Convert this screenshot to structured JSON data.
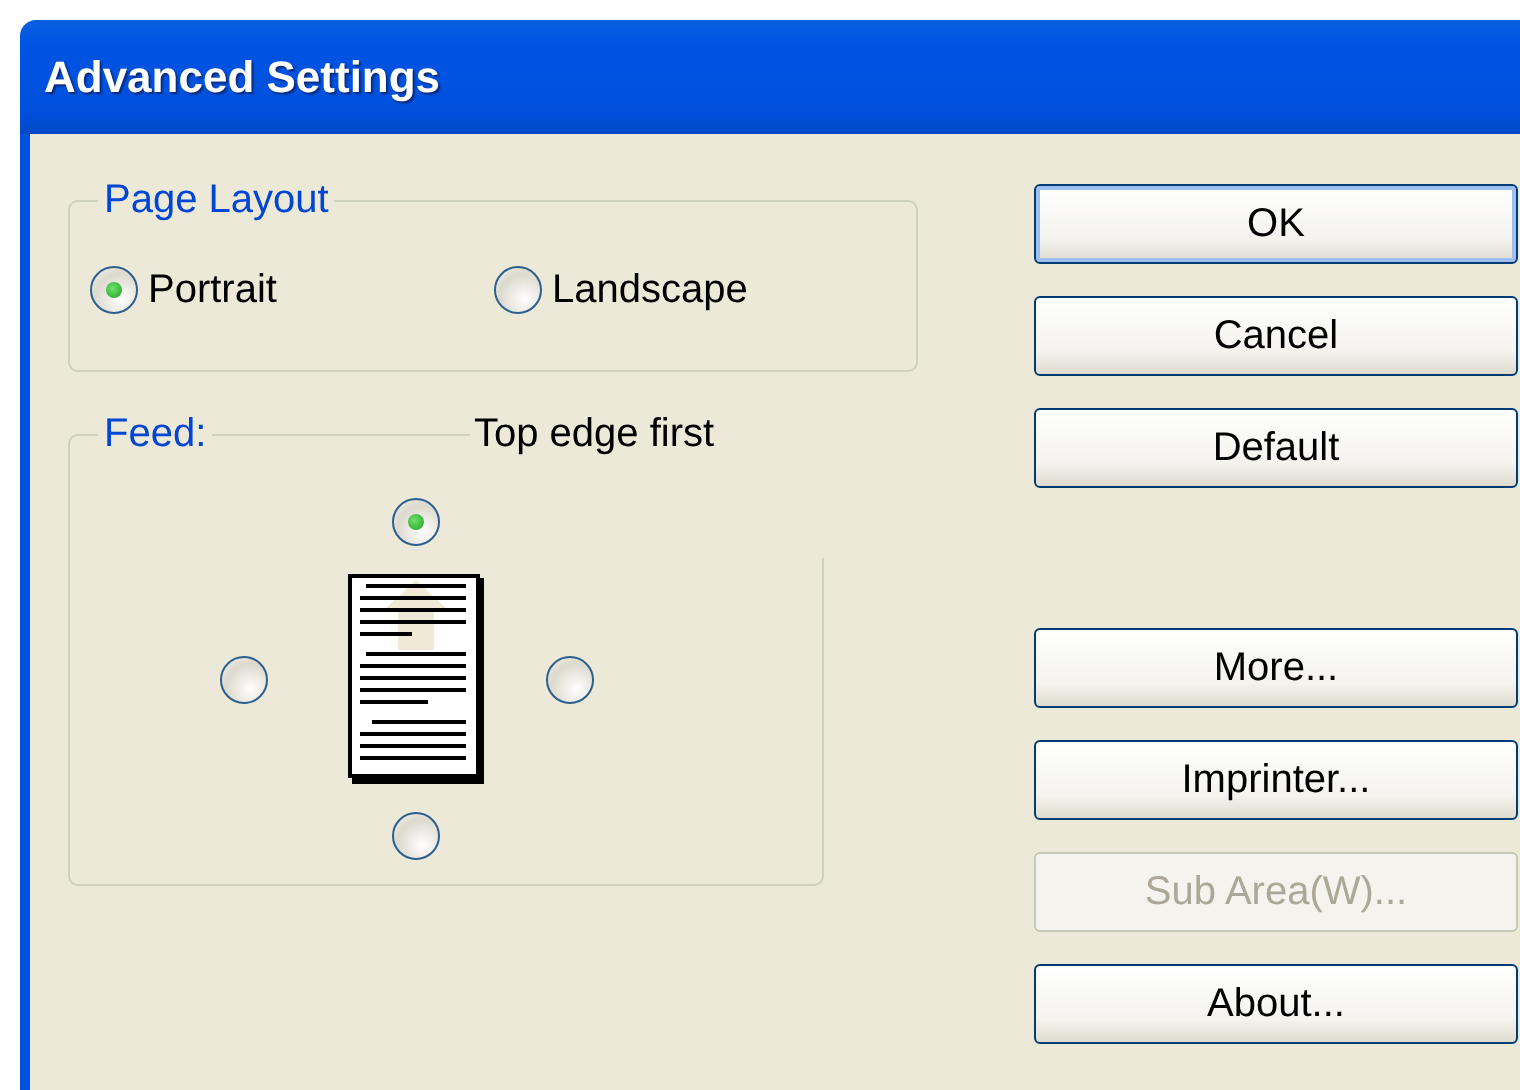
{
  "window": {
    "title": "Advanced Settings"
  },
  "page_layout": {
    "label": "Page Layout",
    "options": [
      {
        "label": "Portrait",
        "selected": true
      },
      {
        "label": "Landscape",
        "selected": false
      }
    ]
  },
  "feed": {
    "label": "Feed:",
    "caption": "Top edge first",
    "options": [
      {
        "kind": "top",
        "selected": true
      },
      {
        "kind": "left",
        "selected": false
      },
      {
        "kind": "right",
        "selected": false
      },
      {
        "kind": "bottom",
        "selected": false
      }
    ]
  },
  "button_groups": [
    [
      {
        "label": "OK",
        "default": true,
        "disabled": false
      },
      {
        "label": "Cancel",
        "default": false,
        "disabled": false
      },
      {
        "label": "Default",
        "default": false,
        "disabled": false
      }
    ],
    [
      {
        "label": "More...",
        "default": false,
        "disabled": false
      },
      {
        "label": "Imprinter...",
        "default": false,
        "disabled": false
      },
      {
        "label": "Sub Area(W)...",
        "default": false,
        "disabled": true
      },
      {
        "label": "About...",
        "default": false,
        "disabled": false
      }
    ]
  ]
}
